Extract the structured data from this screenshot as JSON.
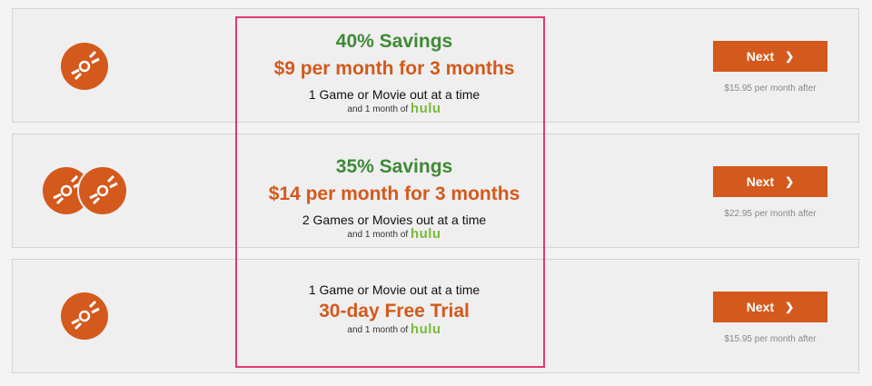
{
  "plans": [
    {
      "savings": "40% Savings",
      "price": "$9 per month for 3 months",
      "description": "1 Game or Movie out at a time",
      "hulu_prefix": "and 1 month of",
      "hulu_brand": "hulu",
      "button_label": "Next",
      "after_price": "$15.95 per month after",
      "disc_icons": 1
    },
    {
      "savings": "35% Savings",
      "price": "$14 per month for 3 months",
      "description": "2 Games or Movies out at a time",
      "hulu_prefix": "and 1 month of",
      "hulu_brand": "hulu",
      "button_label": "Next",
      "after_price": "$22.95 per month after",
      "disc_icons": 2
    },
    {
      "description": "1 Game or Movie out at a time",
      "trial": "30-day Free Trial",
      "hulu_prefix": "and 1 month of",
      "hulu_brand": "hulu",
      "button_label": "Next",
      "after_price": "$15.95 per month after",
      "disc_icons": 1
    }
  ],
  "icons": {
    "disc": "disc-icon",
    "next": "chevron-right-icon"
  },
  "colors": {
    "accent": "#d4591c",
    "savings": "#3e8a36",
    "hulu": "#7bb93b",
    "highlight": "#e23a6e"
  }
}
